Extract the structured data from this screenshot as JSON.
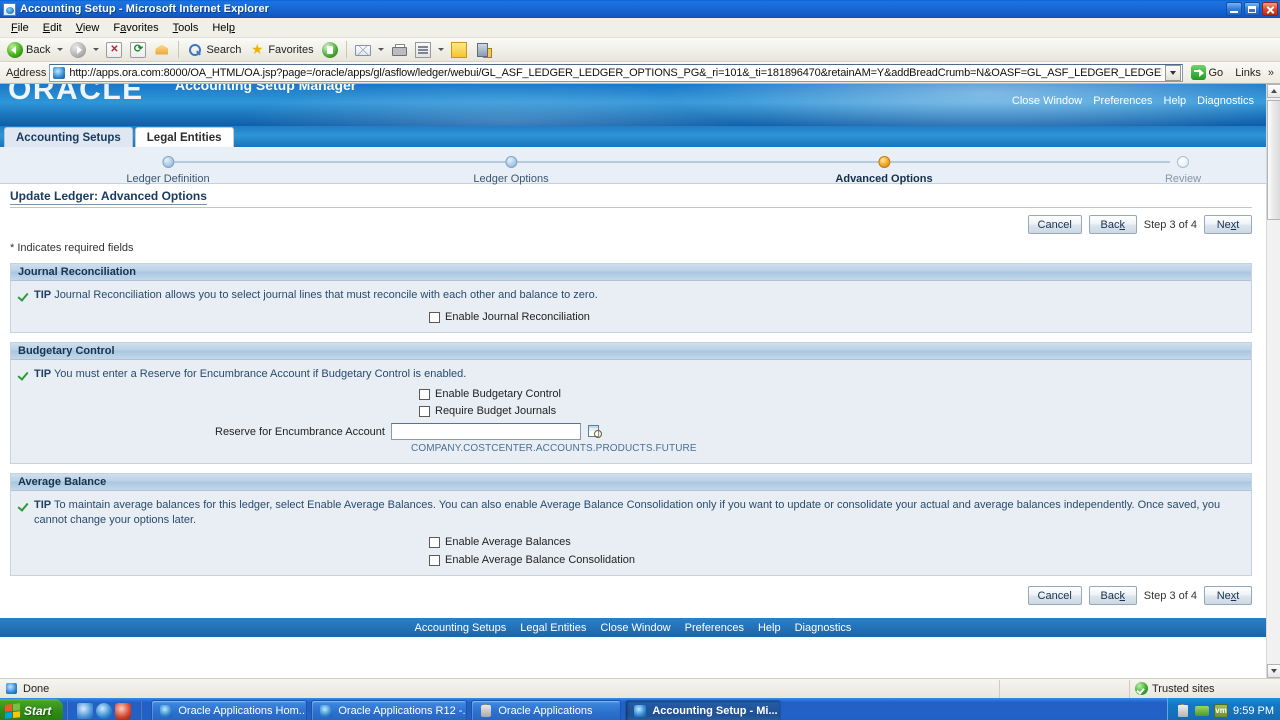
{
  "window": {
    "title": "Accounting Setup - Microsoft Internet Explorer",
    "icon": "ie-document-icon",
    "minimize": "minimize-button",
    "maximize": "restore-button",
    "close": "close-button"
  },
  "menu": {
    "items": [
      "File",
      "Edit",
      "View",
      "Favorites",
      "Tools",
      "Help"
    ]
  },
  "toolbar": {
    "back_label": "Back",
    "search_label": "Search",
    "favorites_label": "Favorites"
  },
  "address": {
    "label": "Address",
    "url": "http://apps.ora.com:8000/OA_HTML/OA.jsp?page=/oracle/apps/gl/asflow/ledger/webui/GL_ASF_LEDGER_LEDGER_OPTIONS_PG&_ri=101&_ti=181896470&retainAM=Y&addBreadCrumb=N&OASF=GL_ASF_LEDGER_LEDGER_OPTIONS&oapc=",
    "go_label": "Go",
    "links_label": "Links",
    "chevron": "»"
  },
  "brand": {
    "logo": "ORACLE",
    "app_name": "Accounting Setup Manager",
    "global_links": [
      "Close Window",
      "Preferences",
      "Help",
      "Diagnostics"
    ]
  },
  "tabs": [
    {
      "label": "Accounting Setups",
      "active": true
    },
    {
      "label": "Legal Entities",
      "active": false
    }
  ],
  "train": {
    "stops": [
      {
        "label": "Ledger Definition",
        "state": "visited"
      },
      {
        "label": "Ledger Options",
        "state": "visited"
      },
      {
        "label": "Advanced Options",
        "state": "active"
      },
      {
        "label": "Review",
        "state": "pending"
      }
    ]
  },
  "page": {
    "heading": "Update Ledger: Advanced Options",
    "required_note": "* Indicates required fields"
  },
  "buttons": {
    "cancel": "Cancel",
    "back_pre": "Bac",
    "back_accel": "k",
    "step": "Step 3 of 4",
    "next_pre": "Ne",
    "next_accel": "x",
    "next_post": "t"
  },
  "sections": [
    {
      "title": "Journal Reconciliation",
      "tip_prefix": "TIP",
      "tip": "Journal Reconciliation allows you to select journal lines that must reconcile with each other and balance to zero.",
      "checkboxes": [
        {
          "label": "Enable Journal Reconciliation",
          "checked": false
        }
      ]
    },
    {
      "title": "Budgetary Control",
      "tip_prefix": "TIP",
      "tip": "You must enter a Reserve for Encumbrance Account if Budgetary Control is enabled.",
      "checkboxes": [
        {
          "label": "Enable Budgetary Control",
          "checked": false
        },
        {
          "label": "Require Budget Journals",
          "checked": false
        }
      ],
      "field": {
        "label": "Reserve for Encumbrance Account",
        "value": "",
        "lov_icon": "flexfield-lov-icon",
        "hint": "COMPANY.COSTCENTER.ACCOUNTS.PRODUCTS.FUTURE"
      }
    },
    {
      "title": "Average Balance",
      "tip_prefix": "TIP",
      "tip": "To maintain average balances for this ledger, select Enable Average Balances. You can also enable Average Balance Consolidation only if you want to update or consolidate your actual and average balances independently. Once saved, you cannot change your options later.",
      "checkboxes": [
        {
          "label": "Enable Average Balances",
          "checked": false
        },
        {
          "label": "Enable Average Balance Consolidation",
          "checked": false
        }
      ]
    }
  ],
  "footer": {
    "links": [
      "Accounting Setups",
      "Legal Entities",
      "Close Window",
      "Preferences",
      "Help",
      "Diagnostics"
    ]
  },
  "statusbar": {
    "message": "Done",
    "zone": "Trusted sites"
  },
  "taskbar": {
    "start": "Start",
    "items": [
      {
        "label": "Oracle Applications Hom...",
        "icon": "ie-icon",
        "active": false
      },
      {
        "label": "Oracle Applications R12 -...",
        "icon": "ie-icon",
        "active": false
      },
      {
        "label": "Oracle Applications",
        "icon": "java-icon",
        "active": false
      },
      {
        "label": "Accounting Setup - Mi...",
        "icon": "ie-icon",
        "active": true
      }
    ],
    "clock": "9:59 PM",
    "tray_vm_label": "vm"
  }
}
